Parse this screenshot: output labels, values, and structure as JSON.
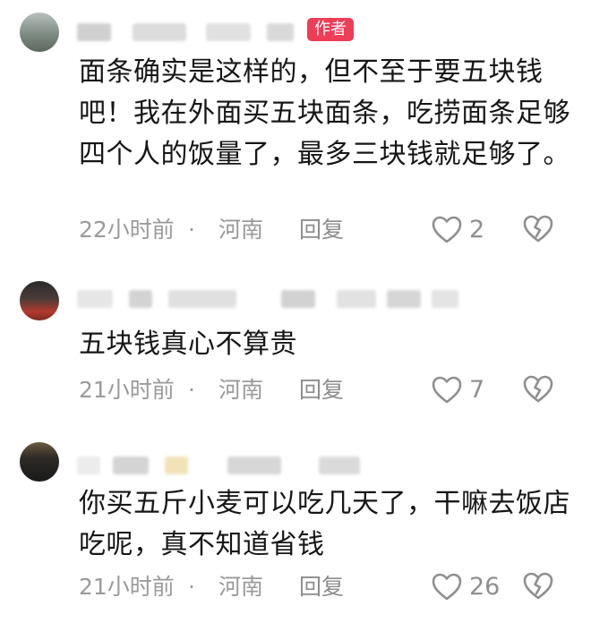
{
  "comments": [
    {
      "author_badge": "作者",
      "text": "面条确实是这样的，但不至于要五块钱吧！我在外面买五块面条，吃捞面条足够四个人的饭量了，最多三块钱就足够了。",
      "time": "22小时前",
      "separator": "·",
      "location": "河南",
      "reply_label": "回复",
      "likes": "2"
    },
    {
      "text": "五块钱真心不算贵",
      "time": "21小时前",
      "separator": "·",
      "location": "河南",
      "reply_label": "回复",
      "likes": "7"
    },
    {
      "text": "你买五斤小麦可以吃几天了，干嘛去饭店吃呢，真不知道省钱",
      "time": "21小时前",
      "separator": "·",
      "location": "河南",
      "reply_label": "回复",
      "likes": "26"
    }
  ],
  "colors": {
    "author_badge_bg": "#ee3d57",
    "meta_text": "#9a9a9a"
  },
  "icons": {
    "like": "heart-outline-icon",
    "dislike": "broken-heart-icon"
  }
}
